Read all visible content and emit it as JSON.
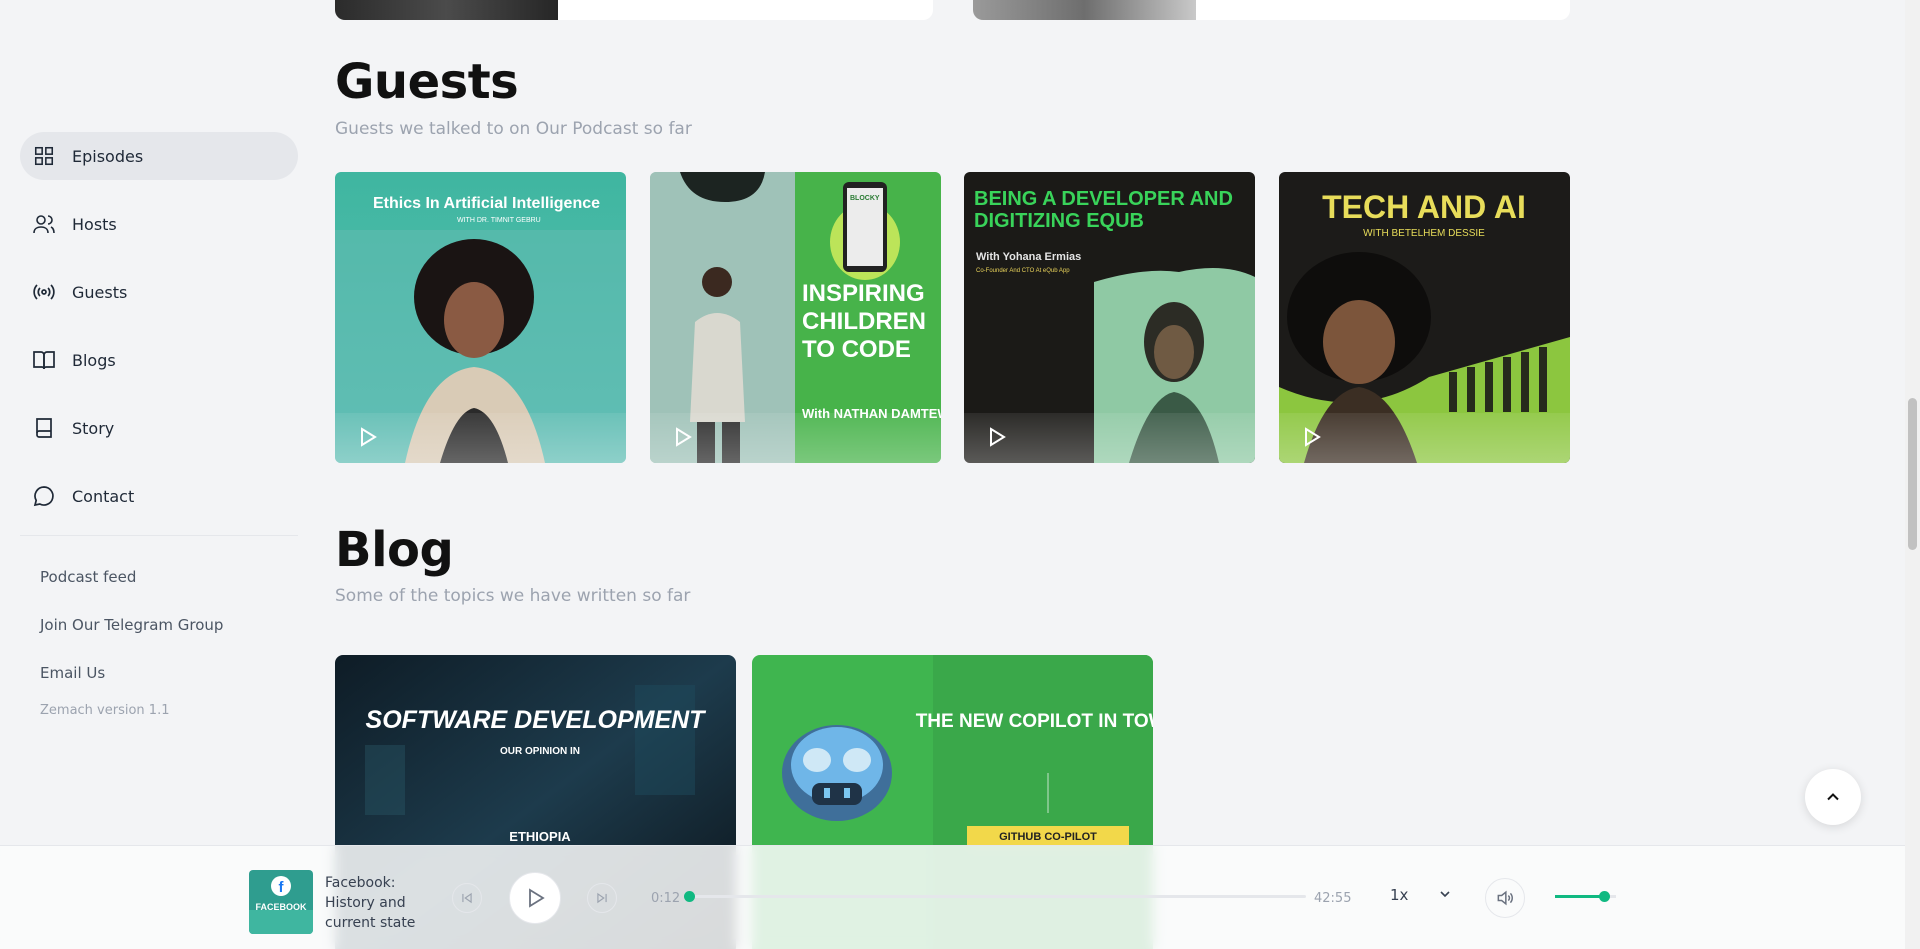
{
  "nav": {
    "items": [
      {
        "label": "Episodes",
        "icon": "grid-icon",
        "active": true
      },
      {
        "label": "Hosts",
        "icon": "users-icon"
      },
      {
        "label": "Guests",
        "icon": "broadcast-icon"
      },
      {
        "label": "Blogs",
        "icon": "open-book-icon"
      },
      {
        "label": "Story",
        "icon": "book-icon"
      },
      {
        "label": "Contact",
        "icon": "chat-bubble-icon"
      }
    ],
    "links": [
      "Podcast feed",
      "Join Our Telegram Group",
      "Email Us"
    ],
    "version": "Zemach version 1.1"
  },
  "guests": {
    "title": "Guests",
    "subtitle": "Guests we talked to on Our Podcast so far",
    "cards": [
      {
        "line1": "Ethics In Artificial Intelligence",
        "line2": "WITH DR. TIMNIT GEBRU"
      },
      {
        "line1": "INSPIRING CHILDREN TO CODE",
        "line2": "With NATHAN DAMTEW",
        "badge": "BLOCKY"
      },
      {
        "line1": "BEING A DEVELOPER AND DIGITIZING EQUB",
        "line2": "With Yohana Ermias",
        "line3": "Co-Founder And CTO At eQub App"
      },
      {
        "line1": "TECH AND AI",
        "line2": "WITH BETELHEM DESSIE"
      }
    ]
  },
  "blog": {
    "title": "Blog",
    "subtitle": "Some of the topics we have written so far",
    "cards": [
      {
        "line1": "SOFTWARE DEVELOPMENT",
        "line2": "OUR OPINION IN",
        "line3": "ETHIOPIA"
      },
      {
        "line1": "THE NEW COPILOT IN TOWN",
        "line2": "GITHUB CO-PILOT"
      }
    ]
  },
  "player": {
    "now_playing": "Facebook: History and current state",
    "thumb_label": "FACEBOOK",
    "elapsed": "0:12",
    "duration": "42:55",
    "rate": "1x",
    "progress_fraction": 0.005,
    "volume_fraction": 0.8
  },
  "colors": {
    "accent": "#10b981",
    "background": "#f3f4f6"
  }
}
